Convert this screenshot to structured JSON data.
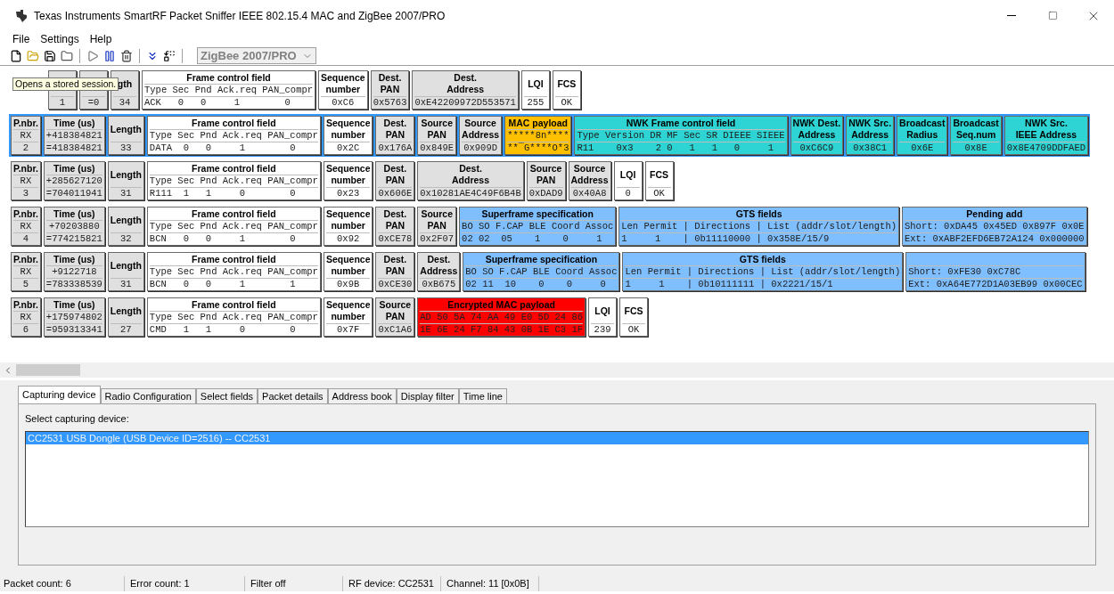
{
  "window": {
    "title": "Texas Instruments SmartRF Packet Sniffer IEEE 802.15.4 MAC and ZigBee 2007/PRO"
  },
  "menu": [
    "File",
    "Settings",
    "Help"
  ],
  "protocol_select": {
    "value": "ZigBee 2007/PRO",
    "disabled": true
  },
  "tooltip": "Opens a stored session.",
  "packets": [
    {
      "selected": false,
      "fields": [
        {
          "kind": "simple",
          "color": "#e0e0e0",
          "values": [
            "1"
          ]
        },
        {
          "kind": "simple",
          "color": "#e0e0e0",
          "values": [
            "=0"
          ]
        },
        {
          "kind": "simple",
          "color": "#e0e0e0",
          "title": [
            "gth"
          ],
          "values": [
            "34"
          ]
        },
        {
          "kind": "table",
          "color": "#ffffff",
          "title": [
            "Frame control field"
          ],
          "values": [
            "Type Sec Pnd Ack.req PAN_compr",
            "ACK   0   0     1        0"
          ]
        },
        {
          "kind": "simple",
          "color": "#ffffff",
          "title": [
            "Sequence",
            "number"
          ],
          "values": [
            "0xC6"
          ]
        },
        {
          "kind": "simple",
          "color": "#e0e0e0",
          "title": [
            "Dest.",
            "PAN"
          ],
          "values": [
            "0x5763"
          ]
        },
        {
          "kind": "simple",
          "color": "#e0e0e0",
          "title": [
            "Dest.",
            "Address"
          ],
          "values": [
            "0xE42209972D553571"
          ]
        },
        {
          "kind": "simple",
          "color": "#ffffff",
          "title": [
            "LQI"
          ],
          "values": [
            "255"
          ]
        },
        {
          "kind": "simple",
          "color": "#ffffff",
          "title": [
            "FCS"
          ],
          "values": [
            "OK"
          ]
        }
      ]
    },
    {
      "selected": true,
      "fields": [
        {
          "kind": "simple",
          "color": "#e0e0e0",
          "title": [
            "P.nbr."
          ],
          "values": [
            "RX",
            "2"
          ]
        },
        {
          "kind": "simple",
          "color": "#e0e0e0",
          "title": [
            "Time (us)"
          ],
          "values": [
            "+418384821",
            "=418384821"
          ]
        },
        {
          "kind": "simple",
          "color": "#e0e0e0",
          "title": [
            "Length"
          ],
          "values": [
            "33"
          ]
        },
        {
          "kind": "table",
          "color": "#ffffff",
          "title": [
            "Frame control field"
          ],
          "values": [
            "Type Sec Pnd Ack.req PAN_compr",
            "DATA  0   0     1        0"
          ]
        },
        {
          "kind": "simple",
          "color": "#ffffff",
          "title": [
            "Sequence",
            "number"
          ],
          "values": [
            "0x2C"
          ]
        },
        {
          "kind": "simple",
          "color": "#e0e0e0",
          "title": [
            "Dest.",
            "PAN"
          ],
          "values": [
            "0x176A"
          ]
        },
        {
          "kind": "simple",
          "color": "#e0e0e0",
          "title": [
            "Source",
            "PAN"
          ],
          "values": [
            "0x849E"
          ]
        },
        {
          "kind": "simple",
          "color": "#e0e0e0",
          "title": [
            "Source",
            "Address"
          ],
          "values": [
            "0x909D"
          ]
        },
        {
          "kind": "simple",
          "color": "#ffc000",
          "title": [
            "MAC payload"
          ],
          "values": [
            "*****8n****",
            "**¯G****O*3"
          ]
        },
        {
          "kind": "table",
          "color": "#2ed3d3",
          "title": [
            "NWK Frame control field"
          ],
          "values": [
            "Type Version DR MF Sec SR DIEEE SIEEE",
            "R11    0x3    2 0   1   1   0     1"
          ]
        },
        {
          "kind": "simple",
          "color": "#2ed3d3",
          "title": [
            "NWK Dest.",
            "Address"
          ],
          "values": [
            "0xC6C9"
          ]
        },
        {
          "kind": "simple",
          "color": "#2ed3d3",
          "title": [
            "NWK Src.",
            "Address"
          ],
          "values": [
            "0x38C1"
          ]
        },
        {
          "kind": "simple",
          "color": "#2ed3d3",
          "title": [
            "Broadcast",
            "Radius"
          ],
          "values": [
            "0x6E"
          ]
        },
        {
          "kind": "simple",
          "color": "#2ed3d3",
          "title": [
            "Broadcast",
            "Seq.num"
          ],
          "values": [
            "0x8E"
          ]
        },
        {
          "kind": "simple",
          "color": "#2ed3d3",
          "title": [
            "NWK Src.",
            "IEEE Address"
          ],
          "values": [
            "0x8E4709DDFAED"
          ]
        }
      ]
    },
    {
      "selected": false,
      "fields": [
        {
          "kind": "simple",
          "color": "#e0e0e0",
          "title": [
            "P.nbr."
          ],
          "values": [
            "RX",
            "3"
          ]
        },
        {
          "kind": "simple",
          "color": "#e0e0e0",
          "title": [
            "Time (us)"
          ],
          "values": [
            "+285627120",
            "=704011941"
          ]
        },
        {
          "kind": "simple",
          "color": "#e0e0e0",
          "title": [
            "Length"
          ],
          "values": [
            "31"
          ]
        },
        {
          "kind": "table",
          "color": "#ffffff",
          "title": [
            "Frame control field"
          ],
          "values": [
            "Type Sec Pnd Ack.req PAN_compr",
            "R111  1   1     0        0"
          ]
        },
        {
          "kind": "simple",
          "color": "#ffffff",
          "title": [
            "Sequence",
            "number"
          ],
          "values": [
            "0x23"
          ]
        },
        {
          "kind": "simple",
          "color": "#e0e0e0",
          "title": [
            "Dest.",
            "PAN"
          ],
          "values": [
            "0x606E"
          ]
        },
        {
          "kind": "simple",
          "color": "#e0e0e0",
          "title": [
            "Dest.",
            "Address"
          ],
          "values": [
            "0x10281AE4C49F6B4B"
          ]
        },
        {
          "kind": "simple",
          "color": "#e0e0e0",
          "title": [
            "Source",
            "PAN"
          ],
          "values": [
            "0xDAD9"
          ]
        },
        {
          "kind": "simple",
          "color": "#e0e0e0",
          "title": [
            "Source",
            "Address"
          ],
          "values": [
            "0x40A8"
          ]
        },
        {
          "kind": "simple",
          "color": "#ffffff",
          "title": [
            "LQI"
          ],
          "values": [
            "0"
          ]
        },
        {
          "kind": "simple",
          "color": "#ffffff",
          "title": [
            "FCS"
          ],
          "values": [
            "OK"
          ]
        }
      ]
    },
    {
      "selected": false,
      "fields": [
        {
          "kind": "simple",
          "color": "#e0e0e0",
          "title": [
            "P.nbr."
          ],
          "values": [
            "RX",
            "4"
          ]
        },
        {
          "kind": "simple",
          "color": "#e0e0e0",
          "title": [
            "Time (us)"
          ],
          "values": [
            "+70203880",
            "=774215821"
          ]
        },
        {
          "kind": "simple",
          "color": "#e0e0e0",
          "title": [
            "Length"
          ],
          "values": [
            "32"
          ]
        },
        {
          "kind": "table",
          "color": "#ffffff",
          "title": [
            "Frame control field"
          ],
          "values": [
            "Type Sec Pnd Ack.req PAN_compr",
            "BCN   0   0     1        0"
          ]
        },
        {
          "kind": "simple",
          "color": "#ffffff",
          "title": [
            "Sequence",
            "number"
          ],
          "values": [
            "0x92"
          ]
        },
        {
          "kind": "simple",
          "color": "#e0e0e0",
          "title": [
            "Dest.",
            "PAN"
          ],
          "values": [
            "0xCE78"
          ]
        },
        {
          "kind": "simple",
          "color": "#e0e0e0",
          "title": [
            "Source",
            "PAN"
          ],
          "values": [
            "0x2F07"
          ]
        },
        {
          "kind": "table",
          "color": "#80bfff",
          "title": [
            "Superframe specification"
          ],
          "values": [
            "BO SO F.CAP BLE Coord Assoc",
            "02 02  05    1    0     1"
          ]
        },
        {
          "kind": "table",
          "color": "#80bfff",
          "title": [
            "GTS fields"
          ],
          "values": [
            "Len Permit | Directions | List (addr/slot/length)",
            "1     1    | 0b11110000 | 0x358E/15/9"
          ]
        },
        {
          "kind": "table",
          "color": "#80bfff",
          "title": [
            "Pending add"
          ],
          "values": [
            "Short: 0xDA45 0x45ED 0x897F 0x0E",
            "Ext: 0xABF2EFD6EB72A124 0x000000"
          ]
        }
      ]
    },
    {
      "selected": false,
      "fields": [
        {
          "kind": "simple",
          "color": "#e0e0e0",
          "title": [
            "P.nbr."
          ],
          "values": [
            "RX",
            "5"
          ]
        },
        {
          "kind": "simple",
          "color": "#e0e0e0",
          "title": [
            "Time (us)"
          ],
          "values": [
            "+9122718",
            "=783338539"
          ]
        },
        {
          "kind": "simple",
          "color": "#e0e0e0",
          "title": [
            "Length"
          ],
          "values": [
            "31"
          ]
        },
        {
          "kind": "table",
          "color": "#ffffff",
          "title": [
            "Frame control field"
          ],
          "values": [
            "Type Sec Pnd Ack.req PAN_compr",
            "BCN   0   0     1        1"
          ]
        },
        {
          "kind": "simple",
          "color": "#ffffff",
          "title": [
            "Sequence",
            "number"
          ],
          "values": [
            "0x9B"
          ]
        },
        {
          "kind": "simple",
          "color": "#e0e0e0",
          "title": [
            "Dest.",
            "PAN"
          ],
          "values": [
            "0xCE30"
          ]
        },
        {
          "kind": "simple",
          "color": "#e0e0e0",
          "title": [
            "Dest.",
            "Address"
          ],
          "values": [
            "0xB675"
          ]
        },
        {
          "kind": "table",
          "color": "#80bfff",
          "title": [
            "Superframe specification"
          ],
          "values": [
            "BO SO F.CAP BLE Coord Assoc",
            "02 11  10    0    0     0"
          ]
        },
        {
          "kind": "table",
          "color": "#80bfff",
          "title": [
            "GTS fields"
          ],
          "values": [
            "Len Permit | Directions | List (addr/slot/length)",
            "1     1    | 0b10111111 | 0x2221/15/1"
          ]
        },
        {
          "kind": "table",
          "color": "#80bfff",
          "values": [
            "Short: 0xFE30 0xC78C",
            "Ext: 0xA64E772D1A03EB99 0x00CEC"
          ]
        }
      ]
    },
    {
      "selected": false,
      "fields": [
        {
          "kind": "simple",
          "color": "#e0e0e0",
          "title": [
            "P.nbr."
          ],
          "values": [
            "RX",
            "6"
          ]
        },
        {
          "kind": "simple",
          "color": "#e0e0e0",
          "title": [
            "Time (us)"
          ],
          "values": [
            "+175974802",
            "=959313341"
          ]
        },
        {
          "kind": "simple",
          "color": "#e0e0e0",
          "title": [
            "Length"
          ],
          "values": [
            "27"
          ]
        },
        {
          "kind": "table",
          "color": "#ffffff",
          "title": [
            "Frame control field"
          ],
          "values": [
            "Type Sec Pnd Ack.req PAN_compr",
            "CMD   1   1     0        0"
          ]
        },
        {
          "kind": "simple",
          "color": "#ffffff",
          "title": [
            "Sequence",
            "number"
          ],
          "values": [
            "0x7F"
          ]
        },
        {
          "kind": "simple",
          "color": "#e0e0e0",
          "title": [
            "Source",
            "PAN"
          ],
          "values": [
            "0xC1A6"
          ]
        },
        {
          "kind": "table",
          "color": "#ff0000",
          "title": [
            "Encrypted MAC payload"
          ],
          "values": [
            "AD 50 5A 74 AA 49 E0 5D 24 86",
            "1E 6E 24 F7 84 43 0B 1E C3 1F"
          ]
        },
        {
          "kind": "simple",
          "color": "#ffffff",
          "title": [
            "LQI"
          ],
          "values": [
            "239"
          ]
        },
        {
          "kind": "simple",
          "color": "#ffffff",
          "title": [
            "FCS"
          ],
          "values": [
            "OK"
          ]
        }
      ]
    }
  ],
  "tabs": [
    {
      "label": "Capturing device",
      "selected": true
    },
    {
      "label": "Radio Configuration",
      "selected": false
    },
    {
      "label": "Select fields",
      "selected": false
    },
    {
      "label": "Packet details",
      "selected": false
    },
    {
      "label": "Address book",
      "selected": false
    },
    {
      "label": "Display filter",
      "selected": false
    },
    {
      "label": "Time line",
      "selected": false
    }
  ],
  "capture_panel": {
    "label": "Select capturing device:",
    "devices": [
      {
        "label": "CC2531 USB Dongle (USB Device ID=2516) -- CC2531",
        "selected": true
      }
    ]
  },
  "status_bar": [
    "Packet count: 6",
    "Error count: 1",
    "Filter off",
    "RF device: CC2531",
    "Channel: 11 [0x0B]"
  ]
}
